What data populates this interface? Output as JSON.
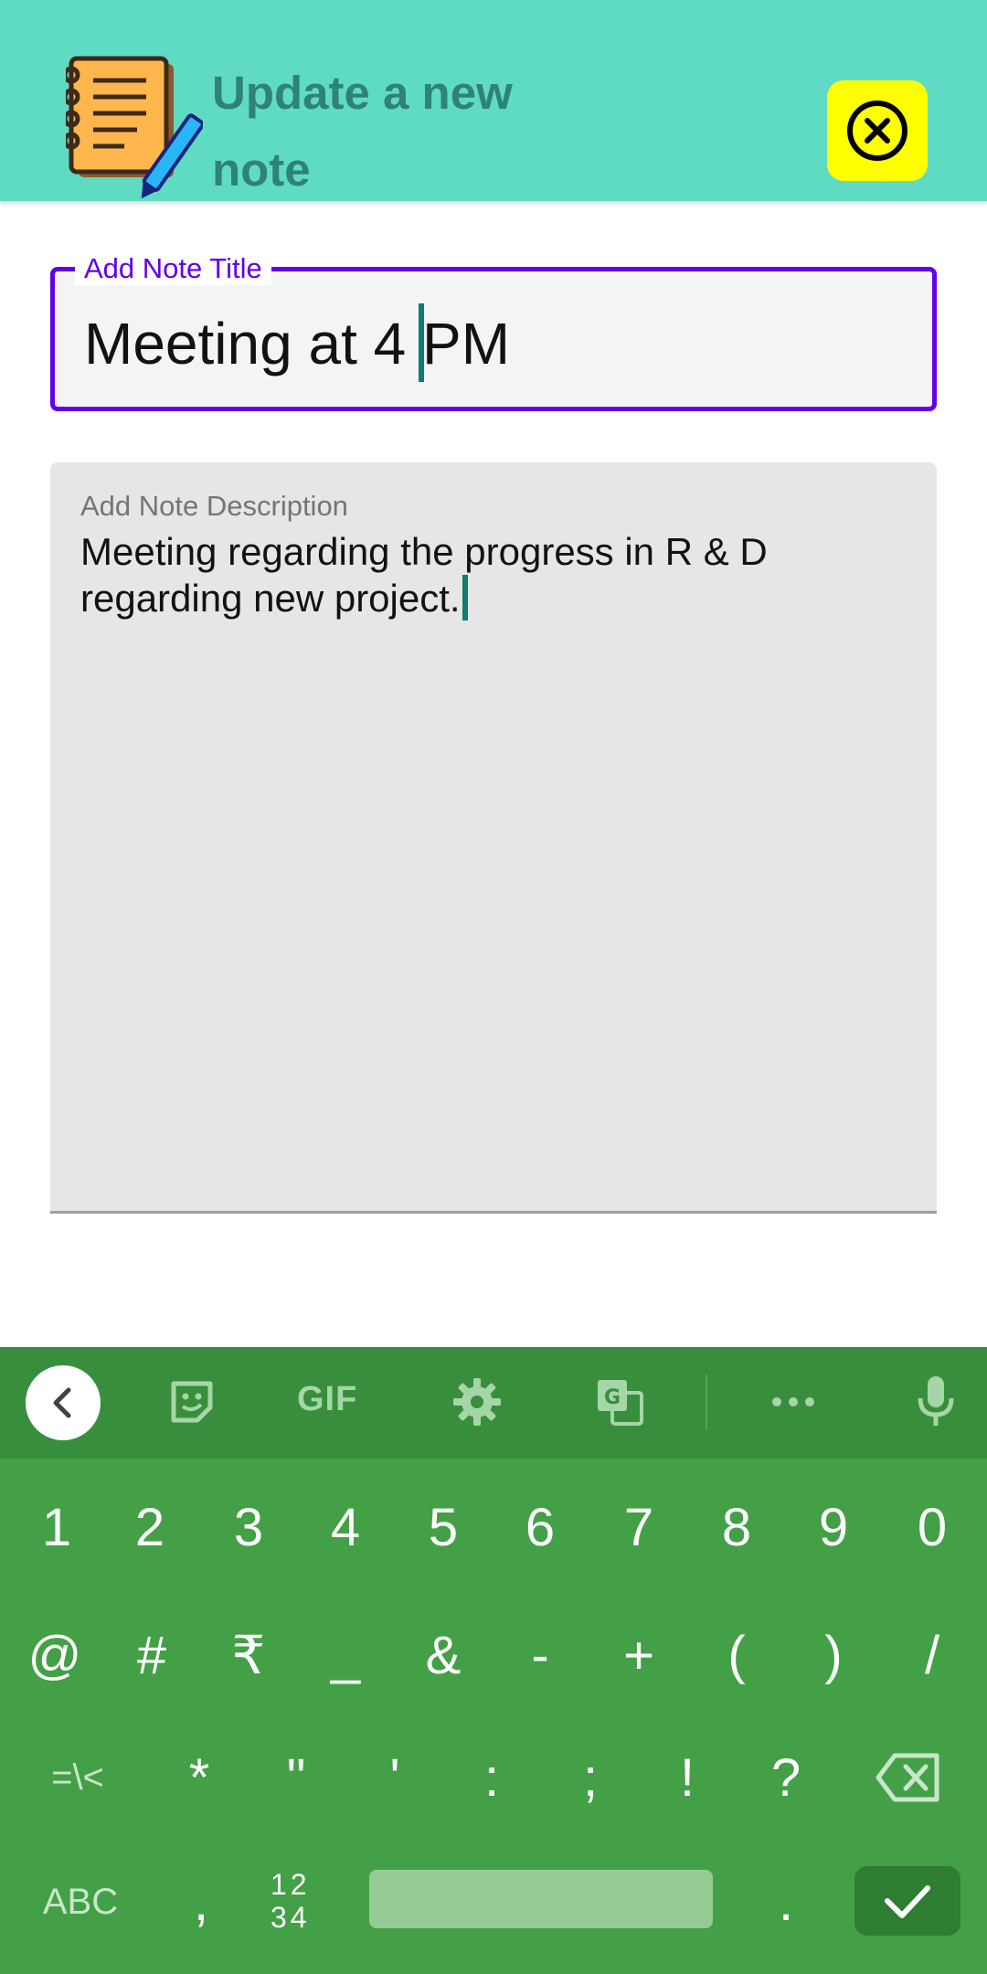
{
  "header": {
    "title": "Update a new note",
    "logo_icon": "notebook-pencil-icon",
    "close_icon": "close-circle-icon",
    "colors": {
      "background": "#5fdbc4",
      "title": "#2f8277",
      "close_button": "#ffff00"
    }
  },
  "title_field": {
    "label": "Add Note Title",
    "value_before_cursor": "Meeting at 4",
    "value_after_cursor": " PM",
    "accent": "#6200ea"
  },
  "description_field": {
    "label": "Add Note Description",
    "value": "Meeting regarding the progress in R & D regarding new project."
  },
  "keyboard": {
    "toolbar": {
      "back_icon": "chevron-left-icon",
      "sticker_icon": "sticker-icon",
      "gif_label": "GIF",
      "settings_icon": "gear-icon",
      "translate_icon": "translate-icon",
      "more_icon": "more-horizontal-icon",
      "mic_icon": "microphone-icon"
    },
    "row1": [
      "1",
      "2",
      "3",
      "4",
      "5",
      "6",
      "7",
      "8",
      "9",
      "0"
    ],
    "row2": [
      "@",
      "#",
      "₹",
      "_",
      "&",
      "-",
      "+",
      "(",
      ")",
      "/"
    ],
    "row3": [
      "=\\<",
      "*",
      "\"",
      "'",
      ":",
      ";",
      "!",
      "?"
    ],
    "row3_backspace_icon": "backspace-icon",
    "row4": {
      "abc": "ABC",
      "comma": ",",
      "numpad_top": "12",
      "numpad_bottom": "34",
      "period": ".",
      "enter_icon": "checkmark-icon"
    },
    "colors": {
      "background": "#43a046",
      "toolbar": "#388e3c",
      "enter": "#2e7d32"
    }
  }
}
